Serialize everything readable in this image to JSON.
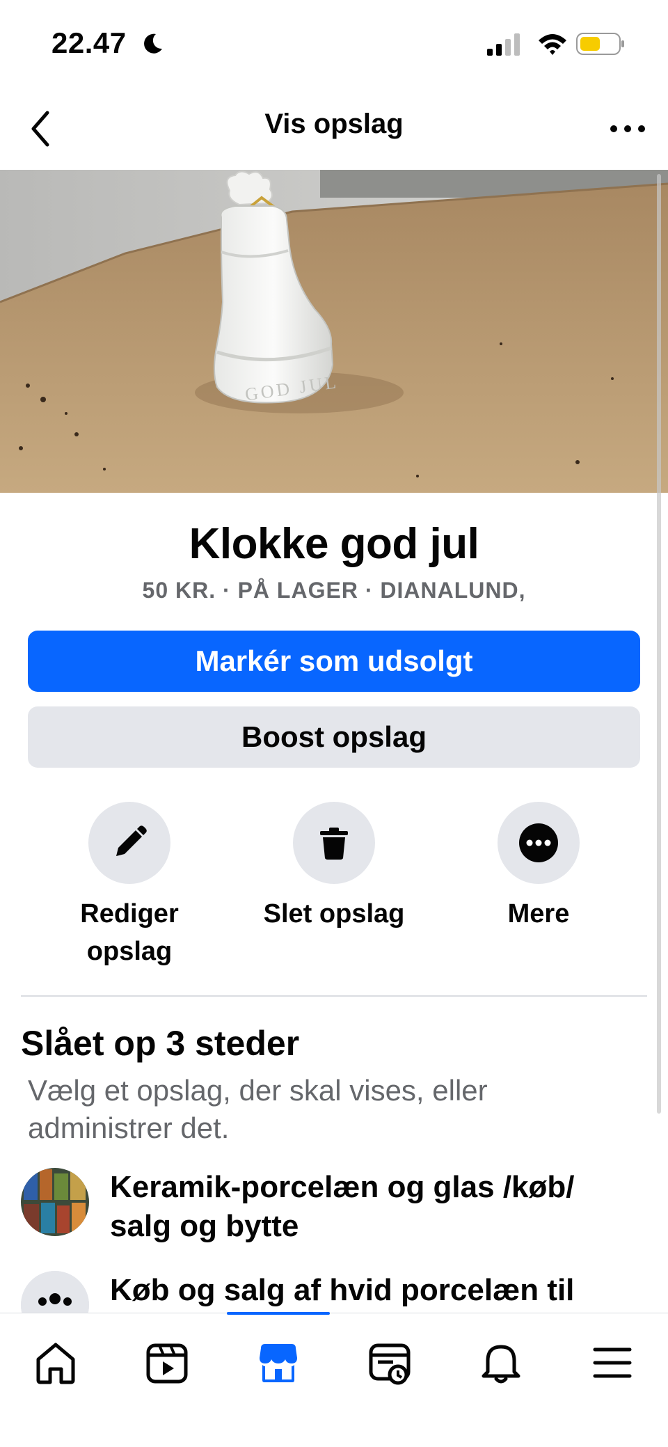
{
  "status_bar": {
    "time": "22.47"
  },
  "header": {
    "title": "Vis opslag"
  },
  "listing": {
    "title": "Klokke god jul",
    "meta": "50 KR. · PÅ LAGER · DIANALUND,",
    "photo_engraving": "GOD JUL"
  },
  "buttons": {
    "mark_sold": "Markér som udsolgt",
    "boost": "Boost opslag"
  },
  "actions": [
    {
      "label": "Rediger opslag",
      "icon": "pencil-icon"
    },
    {
      "label": "Slet opslag",
      "icon": "trash-icon"
    },
    {
      "label": "Mere",
      "icon": "more-icon"
    }
  ],
  "posted_section": {
    "title": "Slået op 3 steder",
    "subtitle": "Vælg et opslag, der skal vises, eller administrer det.",
    "groups": [
      {
        "name": "Keramik-porcelæn og glas /køb/ salg og bytte"
      },
      {
        "name": "Køb og salg af hvid porcelæn til"
      }
    ]
  },
  "bottom_nav": {
    "items": [
      "home-icon",
      "video-icon",
      "marketplace-icon",
      "news-icon",
      "bell-icon",
      "menu-icon"
    ],
    "active": "marketplace-icon"
  },
  "colors": {
    "accent": "#0866ff",
    "secondary_bg": "#e4e6eb",
    "muted_text": "#65676b"
  }
}
